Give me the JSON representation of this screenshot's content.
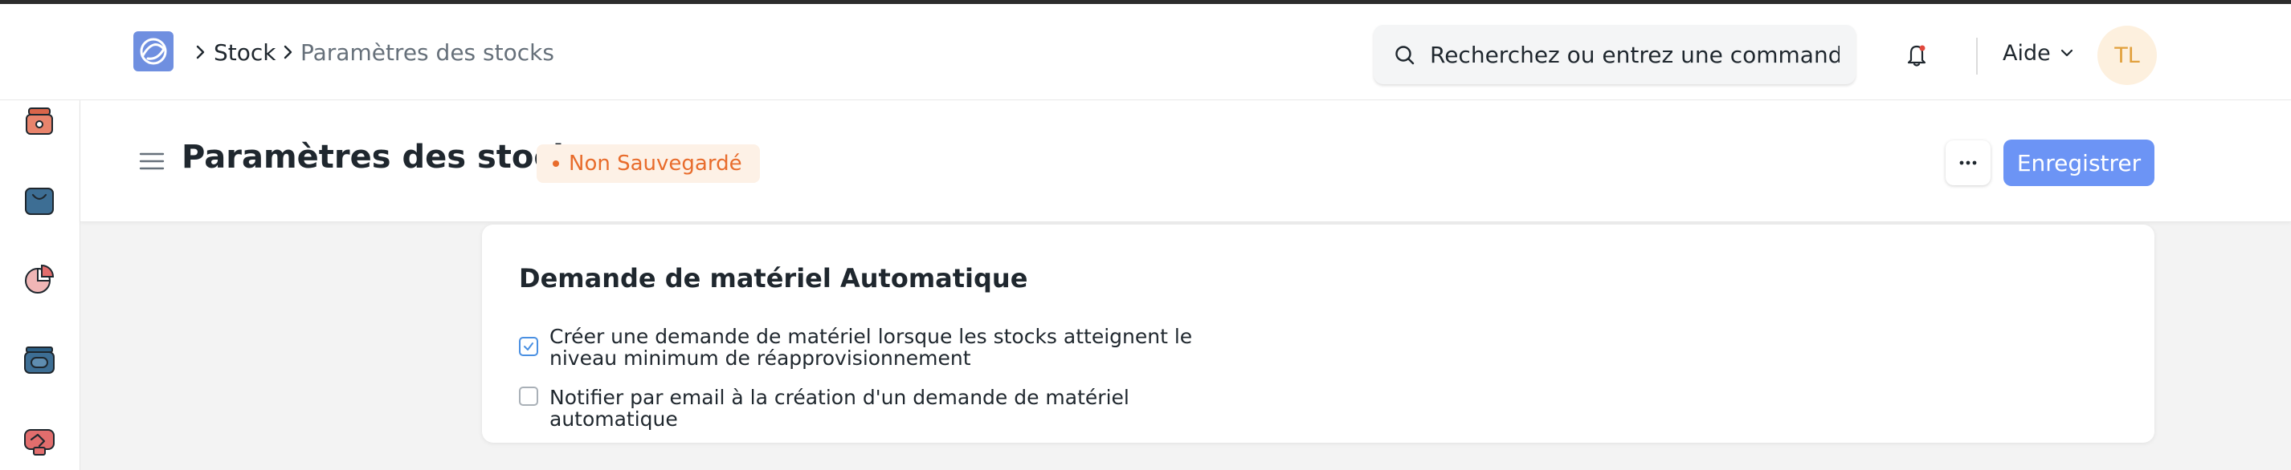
{
  "navbar": {
    "breadcrumbs": [
      "Stock",
      "Paramètres des stocks"
    ],
    "search": {
      "placeholder": "Recherchez ou entrez une commande"
    },
    "help_label": "Aide",
    "avatar_initials": "TL"
  },
  "sidebar": {
    "icons": [
      "module-icon-orange",
      "shopping-bag-icon",
      "pie-chart-icon",
      "wallet-icon",
      "handshake-icon"
    ]
  },
  "page_header": {
    "title": "Paramètres des stocks",
    "status": "Non Sauvegardé",
    "save_label": "Enregistrer",
    "more_label": "···"
  },
  "section": {
    "title": "Demande de matériel Automatique",
    "options": [
      {
        "label": "Créer une demande de matériel lorsque les stocks atteignent le niveau minimum de réapprovisionnement",
        "checked": true
      },
      {
        "label": "Notifier par email à la création d'un demande de matériel automatique",
        "checked": false
      }
    ]
  },
  "colors": {
    "accent": "#6c94f5",
    "status": "#e86c2c",
    "avatar_bg": "#fdf0de",
    "avatar_fg": "#e1a03c"
  }
}
